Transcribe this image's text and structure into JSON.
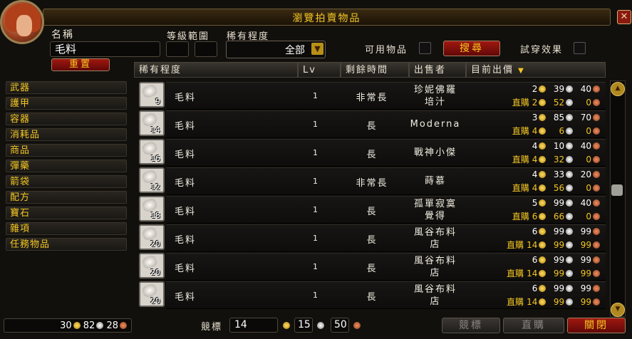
{
  "window": {
    "title": "瀏覽拍賣物品"
  },
  "search": {
    "name_label": "名稱",
    "name_value": "毛料",
    "level_label": "等級範圍",
    "level_min": "",
    "level_max": "",
    "rarity_label": "稀有程度",
    "rarity_value": "全部",
    "usable_label": "可用物品",
    "search_button": "搜尋",
    "preview_label": "試穿效果",
    "reset_button": "重置"
  },
  "categories": [
    "武器",
    "護甲",
    "容器",
    "消耗品",
    "商品",
    "彈藥",
    "箭袋",
    "配方",
    "寶石",
    "雜項",
    "任務物品"
  ],
  "columns": {
    "rarity": "稀有程度",
    "lv": "Lv",
    "time": "剩餘時間",
    "seller": "出售者",
    "price": "目前出價"
  },
  "rows": [
    {
      "count": "9",
      "name": "毛料",
      "lv": "1",
      "time": "非常長",
      "seller": "珍妮佛羅\n培汁",
      "bid": {
        "g": "2",
        "s": "39",
        "c": "40"
      },
      "buyout_label": "直購",
      "buyout": {
        "g": "2",
        "s": "52",
        "c": "0"
      }
    },
    {
      "count": "14",
      "name": "毛料",
      "lv": "1",
      "time": "長",
      "seller": "Moderna",
      "bid": {
        "g": "3",
        "s": "85",
        "c": "70"
      },
      "buyout_label": "直購",
      "buyout": {
        "g": "4",
        "s": "6",
        "c": "0"
      }
    },
    {
      "count": "16",
      "name": "毛料",
      "lv": "1",
      "time": "長",
      "seller": "戰神小傑",
      "bid": {
        "g": "4",
        "s": "10",
        "c": "40"
      },
      "buyout_label": "直購",
      "buyout": {
        "g": "4",
        "s": "32",
        "c": "0"
      }
    },
    {
      "count": "12",
      "name": "毛料",
      "lv": "1",
      "time": "非常長",
      "seller": "蒔慕",
      "bid": {
        "g": "4",
        "s": "33",
        "c": "20"
      },
      "buyout_label": "直購",
      "buyout": {
        "g": "4",
        "s": "56",
        "c": "0"
      }
    },
    {
      "count": "18",
      "name": "毛料",
      "lv": "1",
      "time": "長",
      "seller": "孤單寂寞\n覺得",
      "bid": {
        "g": "5",
        "s": "99",
        "c": "40"
      },
      "buyout_label": "直購",
      "buyout": {
        "g": "6",
        "s": "66",
        "c": "0"
      }
    },
    {
      "count": "20",
      "name": "毛料",
      "lv": "1",
      "time": "長",
      "seller": "風谷布料\n店",
      "bid": {
        "g": "6",
        "s": "99",
        "c": "99"
      },
      "buyout_label": "直購",
      "buyout": {
        "g": "14",
        "s": "99",
        "c": "99"
      }
    },
    {
      "count": "20",
      "name": "毛料",
      "lv": "1",
      "time": "長",
      "seller": "風谷布料\n店",
      "bid": {
        "g": "6",
        "s": "99",
        "c": "99"
      },
      "buyout_label": "直購",
      "buyout": {
        "g": "14",
        "s": "99",
        "c": "99"
      }
    },
    {
      "count": "20",
      "name": "毛料",
      "lv": "1",
      "time": "長",
      "seller": "風谷布料\n店",
      "bid": {
        "g": "6",
        "s": "99",
        "c": "99"
      },
      "buyout_label": "直購",
      "buyout": {
        "g": "14",
        "s": "99",
        "c": "99"
      }
    }
  ],
  "footer": {
    "money": {
      "g": "30",
      "s": "82",
      "c": "28"
    },
    "bid_label": "競標",
    "bid_gold": "14",
    "bid_silver": "15",
    "bid_copper": "50",
    "bid_button": "競標",
    "buyout_button": "直購",
    "close_button": "關閉"
  },
  "colors": {
    "gold_text": "#f3c623",
    "red_button": "#a01810",
    "background": "#12100d"
  }
}
